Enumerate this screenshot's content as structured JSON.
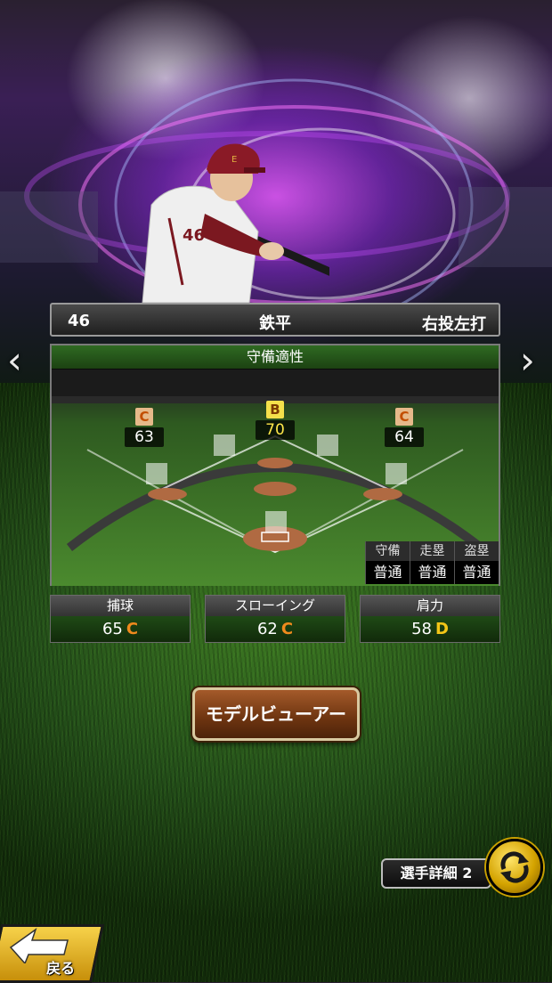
{
  "player": {
    "number": "46",
    "name": "鉄平",
    "handedness": "右投左打"
  },
  "defense_panel": {
    "title": "守備適性",
    "positions": [
      {
        "grade": "C",
        "value": "63"
      },
      {
        "grade": "B",
        "value": "70"
      },
      {
        "grade": "C",
        "value": "64"
      }
    ],
    "mini_table": {
      "headers": [
        "守備",
        "走塁",
        "盗塁"
      ],
      "values": [
        "普通",
        "普通",
        "普通"
      ]
    }
  },
  "stats": [
    {
      "label": "捕球",
      "value": "65",
      "grade": "C"
    },
    {
      "label": "スローイング",
      "value": "62",
      "grade": "C"
    },
    {
      "label": "肩力",
      "value": "58",
      "grade": "D"
    }
  ],
  "buttons": {
    "model_viewer": "モデルビューアー",
    "player_detail": "選手詳細 2",
    "back": "戻る"
  },
  "nav": {
    "prev_icon": "‹",
    "next_icon": "›"
  },
  "colors": {
    "grade_c": "#f08a1d",
    "grade_b": "#ffe74a",
    "grade_d": "#f3c617",
    "panel_header": "#2f6a22"
  }
}
